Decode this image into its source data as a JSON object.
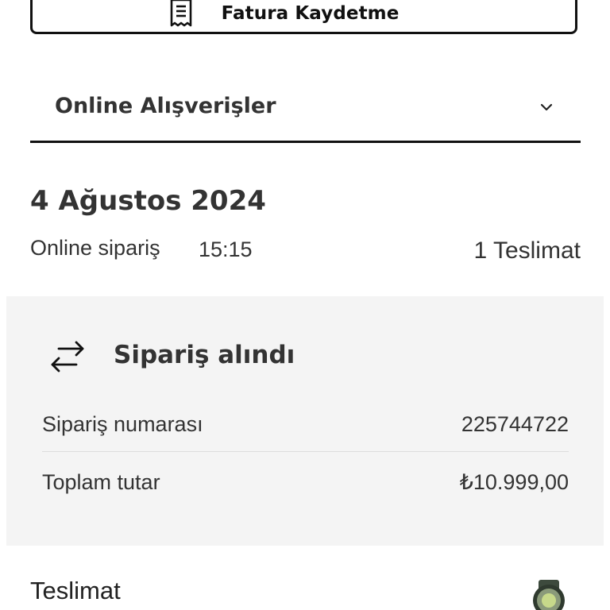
{
  "invoice_button": {
    "label": "Fatura Kaydetme",
    "icon": "receipt-icon"
  },
  "accordion": {
    "title": "Online Alışverişler",
    "icon": "chevron-down-icon"
  },
  "order": {
    "date": "4 Ağustos 2024",
    "type": "Online sipariş",
    "time": "15:15",
    "delivery_count": "1 Teslimat"
  },
  "status_card": {
    "icon": "swap-arrows-icon",
    "title": "Sipariş alındı",
    "rows": [
      {
        "label": "Sipariş numarası",
        "value": "225744722"
      },
      {
        "label": "Toplam tutar",
        "value": "₺10.999,00"
      }
    ]
  },
  "delivery": {
    "title": "Teslimat",
    "thumbnail": "smartwatch-image"
  },
  "colors": {
    "border": "#111111",
    "card_bg": "#f4f4f4",
    "text": "#333333"
  }
}
